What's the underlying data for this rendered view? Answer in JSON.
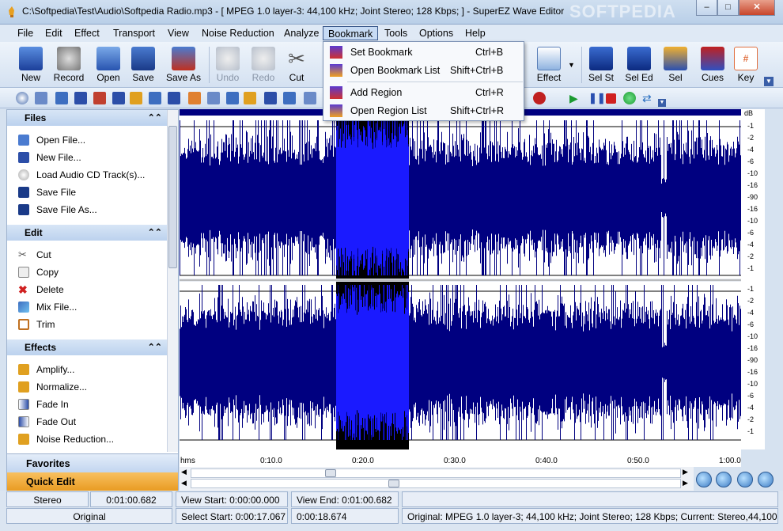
{
  "window": {
    "title": "C:\\Softpedia\\Test\\Audio\\Softpedia Radio.mp3 - [ MPEG 1.0 layer-3: 44,100 kHz; Joint Stereo; 128 Kbps;  ] - SuperEZ Wave Editor",
    "minimize": "–",
    "maximize": "□",
    "close": "✕",
    "watermark": "SOFTPEDIA"
  },
  "menubar": [
    "File",
    "Edit",
    "Effect",
    "Transport",
    "View",
    "Noise Reduction",
    "Analyze",
    "Bookmark",
    "Tools",
    "Options",
    "Help"
  ],
  "bookmark_menu": [
    {
      "label": "Set Bookmark",
      "shortcut": "Ctrl+B",
      "icon": "set-bookmark-icon"
    },
    {
      "label": "Open Bookmark List",
      "shortcut": "Shift+Ctrl+B",
      "icon": "bookmark-list-icon"
    },
    {
      "label": "Add Region",
      "shortcut": "Ctrl+R",
      "icon": "add-region-icon"
    },
    {
      "label": "Open Region List",
      "shortcut": "Shift+Ctrl+R",
      "icon": "region-list-icon"
    }
  ],
  "toolbar": [
    {
      "label": "New",
      "icon": "new-audio-icon",
      "enabled": true
    },
    {
      "label": "Record",
      "icon": "microphone-icon",
      "enabled": true
    },
    {
      "label": "Open",
      "icon": "open-folder-icon",
      "enabled": true
    },
    {
      "label": "Save",
      "icon": "floppy-disk-icon",
      "enabled": true
    },
    {
      "label": "Save As",
      "icon": "save-as-icon",
      "enabled": true
    },
    {
      "label": "Undo",
      "icon": "undo-icon",
      "enabled": false
    },
    {
      "label": "Redo",
      "icon": "redo-icon",
      "enabled": false
    },
    {
      "label": "Cut",
      "icon": "scissors-icon",
      "enabled": true
    },
    {
      "label": "Effect",
      "icon": "effect-icon",
      "enabled": true
    },
    {
      "label": "Sel St",
      "icon": "select-start-icon",
      "enabled": true
    },
    {
      "label": "Sel Ed",
      "icon": "select-end-icon",
      "enabled": true
    },
    {
      "label": "Sel",
      "icon": "select-icon",
      "enabled": true
    },
    {
      "label": "Cues",
      "icon": "cues-icon",
      "enabled": true
    },
    {
      "label": "Key",
      "icon": "key-icon",
      "enabled": true
    }
  ],
  "panel": {
    "sections": [
      {
        "title": "Files",
        "items": [
          {
            "label": "Open File...",
            "icon": "open-file-icon"
          },
          {
            "label": "New File...",
            "icon": "new-file-icon"
          },
          {
            "label": "Load Audio CD Track(s)...",
            "icon": "cd-icon"
          },
          {
            "label": "Save File",
            "icon": "save-file-icon"
          },
          {
            "label": "Save File As...",
            "icon": "save-file-as-icon"
          }
        ]
      },
      {
        "title": "Edit",
        "items": [
          {
            "label": "Cut",
            "icon": "cut-icon"
          },
          {
            "label": "Copy",
            "icon": "copy-icon"
          },
          {
            "label": "Delete",
            "icon": "delete-icon"
          },
          {
            "label": "Mix File...",
            "icon": "mix-file-icon"
          },
          {
            "label": "Trim",
            "icon": "trim-icon"
          }
        ]
      },
      {
        "title": "Effects",
        "items": [
          {
            "label": "Amplify...",
            "icon": "amplify-icon"
          },
          {
            "label": "Normalize...",
            "icon": "normalize-icon"
          },
          {
            "label": "Fade In",
            "icon": "fade-in-icon"
          },
          {
            "label": "Fade Out",
            "icon": "fade-out-icon"
          },
          {
            "label": "Noise Reduction...",
            "icon": "noise-reduction-icon"
          }
        ]
      }
    ],
    "favorites": "Favorites",
    "quick_edit": "Quick Edit"
  },
  "db_scale": {
    "unit": "dB",
    "labels": [
      "-1",
      "-2",
      "-4",
      "-6",
      "-10",
      "-16",
      "-90",
      "-16",
      "-10",
      "-6",
      "-4",
      "-2",
      "-1"
    ]
  },
  "timeline": [
    "hms",
    "0:10.0",
    "0:20.0",
    "0:30.0",
    "0:40.0",
    "0:50.0",
    "1:00.0"
  ],
  "selection": {
    "start": "0:00:17.067",
    "end": "0:00:18.674"
  },
  "status": {
    "channels": "Stereo",
    "duration": "0:01:00.682",
    "view_start": "View Start: 0:00:00.000",
    "view_end": "View End: 0:01:00.682",
    "original": "Original",
    "select_start": "Select Start: 0:00:17.067",
    "select_end": "0:00:18.674",
    "format": "Original: MPEG 1.0 layer-3; 44,100 kHz; Joint Stereo; 128 Kbps;  Current: Stereo,44,100 Hz"
  },
  "colors": {
    "waveform": "#000080",
    "selection": "#1a1aff",
    "selection_bg": "#000000",
    "quick_edit": "#f0a830",
    "favorites": "#cfe0f5"
  }
}
